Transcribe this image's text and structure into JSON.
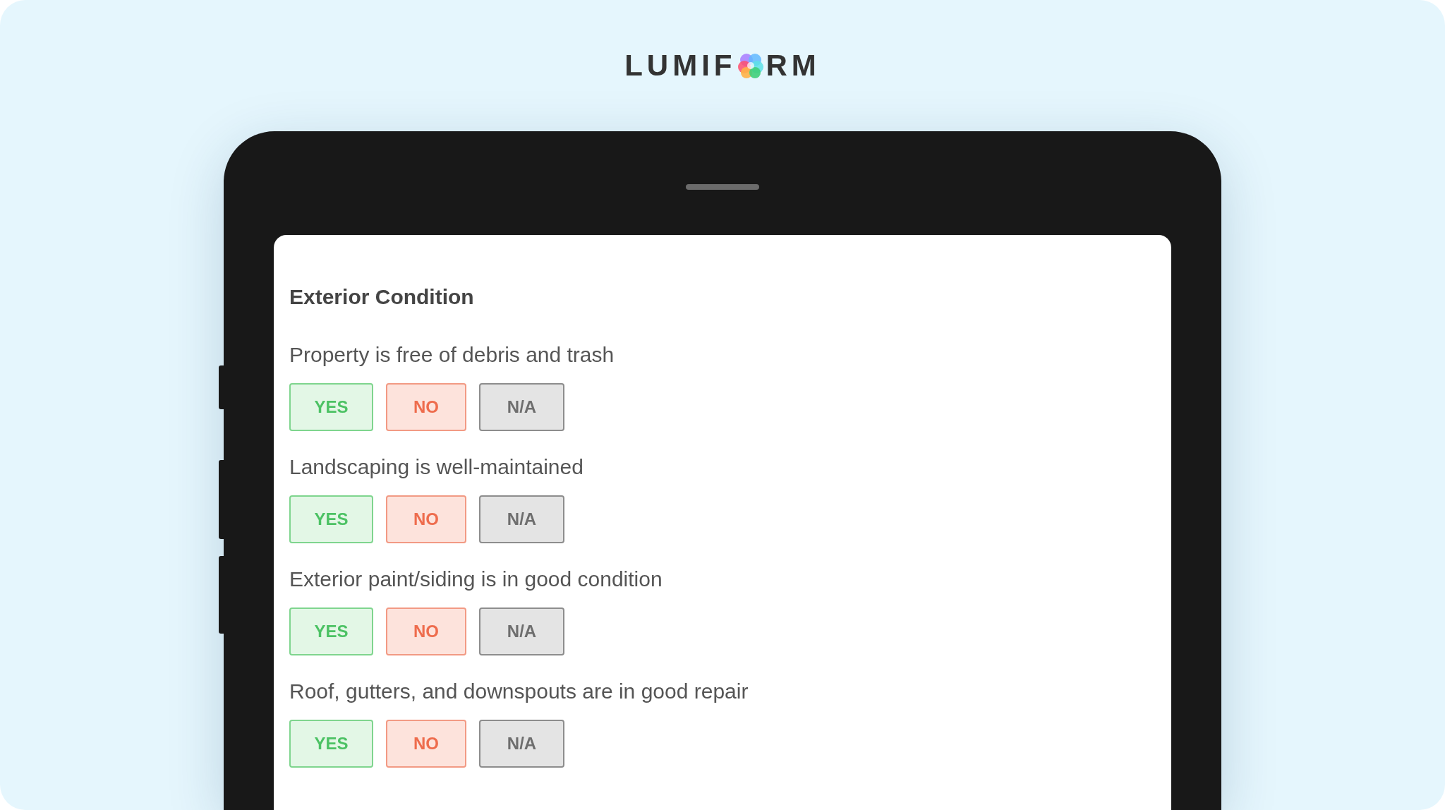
{
  "logo": {
    "before": "LUMIF",
    "after": "RM"
  },
  "section": {
    "title": "Exterior Condition"
  },
  "questions": [
    {
      "text": "Property is free of debris and trash",
      "options": [
        {
          "label": "YES",
          "kind": "yes"
        },
        {
          "label": "NO",
          "kind": "no"
        },
        {
          "label": "N/A",
          "kind": "na"
        }
      ]
    },
    {
      "text": "Landscaping is well-maintained",
      "options": [
        {
          "label": "YES",
          "kind": "yes"
        },
        {
          "label": "NO",
          "kind": "no"
        },
        {
          "label": "N/A",
          "kind": "na"
        }
      ]
    },
    {
      "text": "Exterior paint/siding is in good condition",
      "options": [
        {
          "label": "YES",
          "kind": "yes"
        },
        {
          "label": "NO",
          "kind": "no"
        },
        {
          "label": "N/A",
          "kind": "na"
        }
      ]
    },
    {
      "text": "Roof, gutters, and downspouts are in good repair",
      "options": [
        {
          "label": "YES",
          "kind": "yes"
        },
        {
          "label": "NO",
          "kind": "no"
        },
        {
          "label": "N/A",
          "kind": "na"
        }
      ]
    }
  ]
}
